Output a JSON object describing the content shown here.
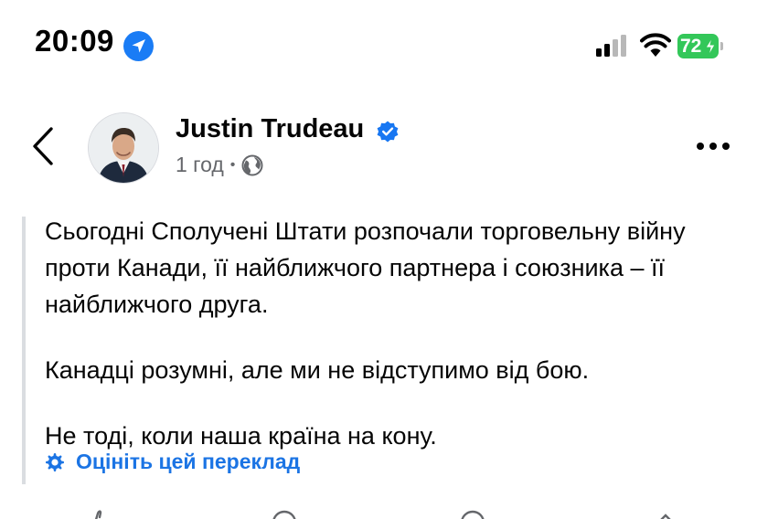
{
  "status_bar": {
    "time": "20:09",
    "battery_percent": "72",
    "battery_color": "#33c759",
    "icons": [
      "location-arrow-icon",
      "cellular-signal-icon",
      "wifi-icon",
      "battery-charging-icon"
    ]
  },
  "header": {
    "author_name": "Justin Trudeau",
    "verified": true,
    "post_time": "1 год",
    "separator": "•",
    "audience_icon": "globe-icon",
    "icons": [
      "chevron-left-icon",
      "verified-badge-icon",
      "more-horizontal-icon"
    ]
  },
  "post": {
    "paragraphs": [
      "Сьогодні Сполучені Штати розпочали торговельну війну проти Канади, її найближчого партнера і союзника – її найближчого друга.",
      "Канадці розумні, але ми не відступимо від бою.",
      "Не тоді, коли наша країна на кону."
    ],
    "rate_translation_label": "Оцініть цей переклад",
    "link_color": "#1b74e4"
  }
}
